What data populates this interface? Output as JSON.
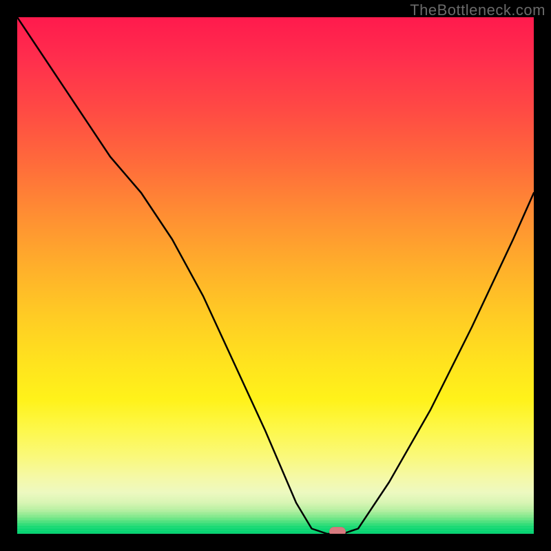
{
  "watermark": "TheBottleneck.com",
  "chart_data": {
    "type": "line",
    "title": "",
    "xlabel": "",
    "ylabel": "",
    "xlim": [
      0,
      100
    ],
    "ylim": [
      0,
      100
    ],
    "background_gradient": {
      "orientation": "vertical",
      "stops": [
        {
          "pos": 0,
          "color": "#ff1a4d"
        },
        {
          "pos": 18,
          "color": "#ff4a44"
        },
        {
          "pos": 38,
          "color": "#ff8d33"
        },
        {
          "pos": 58,
          "color": "#ffcc24"
        },
        {
          "pos": 74,
          "color": "#fff21a"
        },
        {
          "pos": 89,
          "color": "#f5f9a6"
        },
        {
          "pos": 96,
          "color": "#7de88a"
        },
        {
          "pos": 100,
          "color": "#04d372"
        }
      ]
    },
    "series": [
      {
        "name": "bottleneck-curve",
        "color": "#000000",
        "x": [
          0,
          6,
          12,
          18,
          24,
          30,
          36,
          42,
          48,
          54,
          57,
          60,
          63,
          66,
          72,
          80,
          88,
          96,
          100
        ],
        "y": [
          100,
          91,
          82,
          73,
          66,
          57,
          46,
          33,
          20,
          6,
          1,
          0,
          0,
          1,
          10,
          24,
          40,
          57,
          66
        ]
      }
    ],
    "marker": {
      "name": "optimal-point",
      "x": 62,
      "y": 0,
      "color": "#d77a7f",
      "shape": "pill"
    }
  }
}
